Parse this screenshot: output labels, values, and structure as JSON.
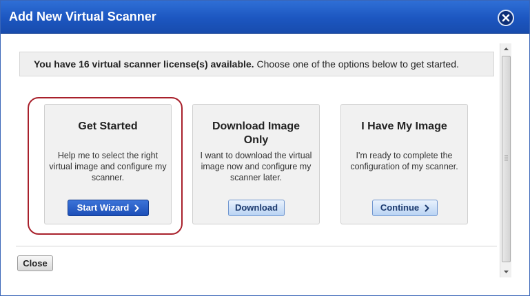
{
  "dialog": {
    "title": "Add New Virtual Scanner"
  },
  "license": {
    "bold_text": "You have 16 virtual scanner license(s) available.",
    "rest_text": " Choose one of the options below to get started."
  },
  "cards": [
    {
      "title": "Get Started",
      "description": "Help me to select the right virtual image and configure my scanner.",
      "button_label": "Start Wizard",
      "button_icon": "chevron-right-icon"
    },
    {
      "title": "Download Image Only",
      "description": "I want to download the virtual image now and configure my scanner later.",
      "button_label": "Download"
    },
    {
      "title": "I Have My Image",
      "description": "I'm ready to complete the configuration of my scanner.",
      "button_label": "Continue",
      "button_icon": "chevron-right-icon"
    }
  ],
  "footer": {
    "close_label": "Close"
  },
  "colors": {
    "titlebar": "#1c56c0",
    "primary_button": "#1d4fb8",
    "highlight_ring": "#a8202b"
  }
}
